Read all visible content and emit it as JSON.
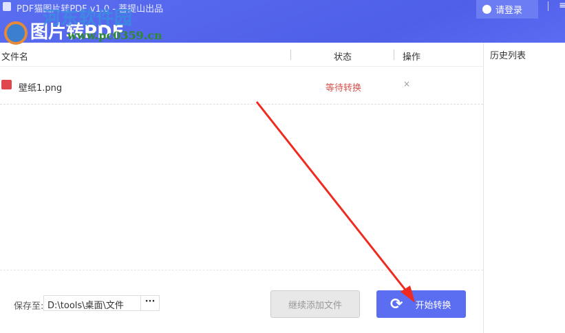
{
  "window": {
    "title": "PDF猫图片转PDF v1.0 - 菩提山出品",
    "logo": "图片转PDF",
    "login": "请登录",
    "menu": "≡"
  },
  "watermark": {
    "name": "河东软件园",
    "url": "www.pc0359.cn"
  },
  "table": {
    "headers": [
      "文件名",
      "状态",
      "操作"
    ],
    "rows": [
      {
        "name": "壁纸1.png",
        "status": "等待转换",
        "action": "×"
      }
    ]
  },
  "history": {
    "title": "历史列表"
  },
  "footer": {
    "save_label": "保存至:",
    "path": "D:\\tools\\桌面\\文件",
    "browse": "···",
    "add_button": "继续添加文件",
    "start_button": "开始转换"
  }
}
